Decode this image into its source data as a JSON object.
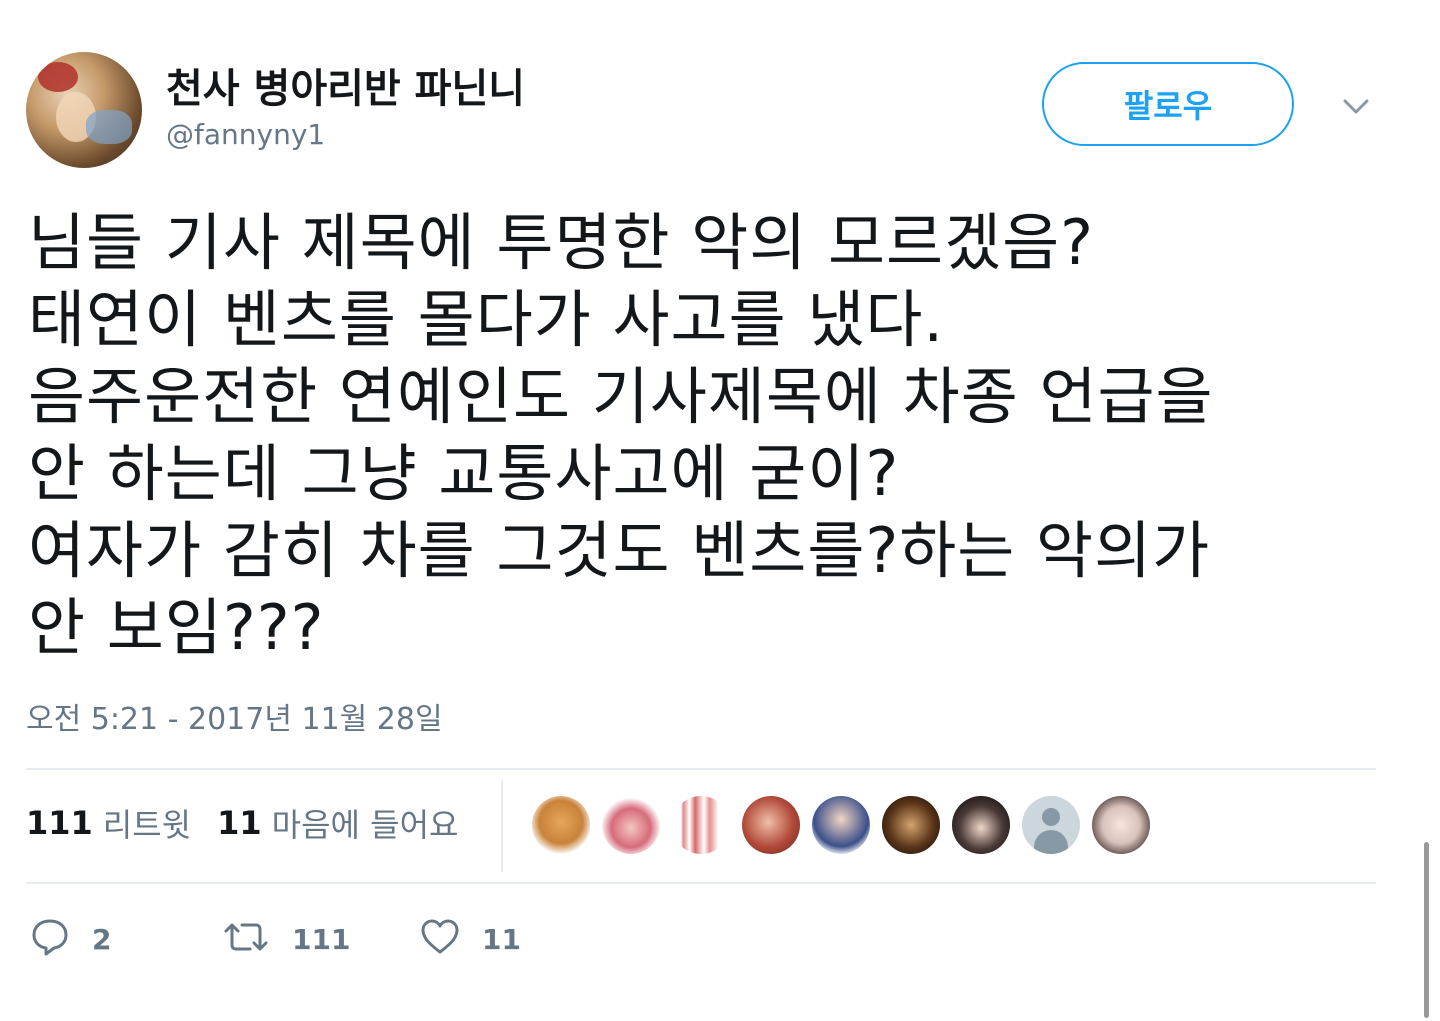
{
  "user": {
    "display_name": "천사 병아리반 파닌니",
    "handle": "@fannyny1"
  },
  "follow_button": {
    "label": "팔로우"
  },
  "tweet": {
    "lines": [
      "님들 기사 제목에 투명한 악의 모르겠음?",
      "태연이 벤츠를 몰다가 사고를 냈다.",
      "음주운전한 연예인도 기사제목에 차종 언급을",
      "안 하는데 그냥 교통사고에 굳이?",
      "여자가 감히 차를 그것도 벤츠를?하는 악의가",
      "안 보임???"
    ],
    "timestamp": "오전 5:21 - 2017년 11월 28일"
  },
  "stats": {
    "retweets_count": "111",
    "retweets_label": "리트윗",
    "likes_count": "11",
    "likes_label": "마음에 들어요"
  },
  "actions": {
    "reply_count": "2",
    "retweet_count": "111",
    "like_count": "11"
  },
  "colors": {
    "accent": "#1da1f2",
    "text": "#14171a",
    "secondary": "#657786",
    "divider": "#e6ecf0"
  },
  "icons": {
    "reply": "reply-icon",
    "retweet": "retweet-icon",
    "like": "heart-icon",
    "caret": "chevron-down-icon"
  }
}
